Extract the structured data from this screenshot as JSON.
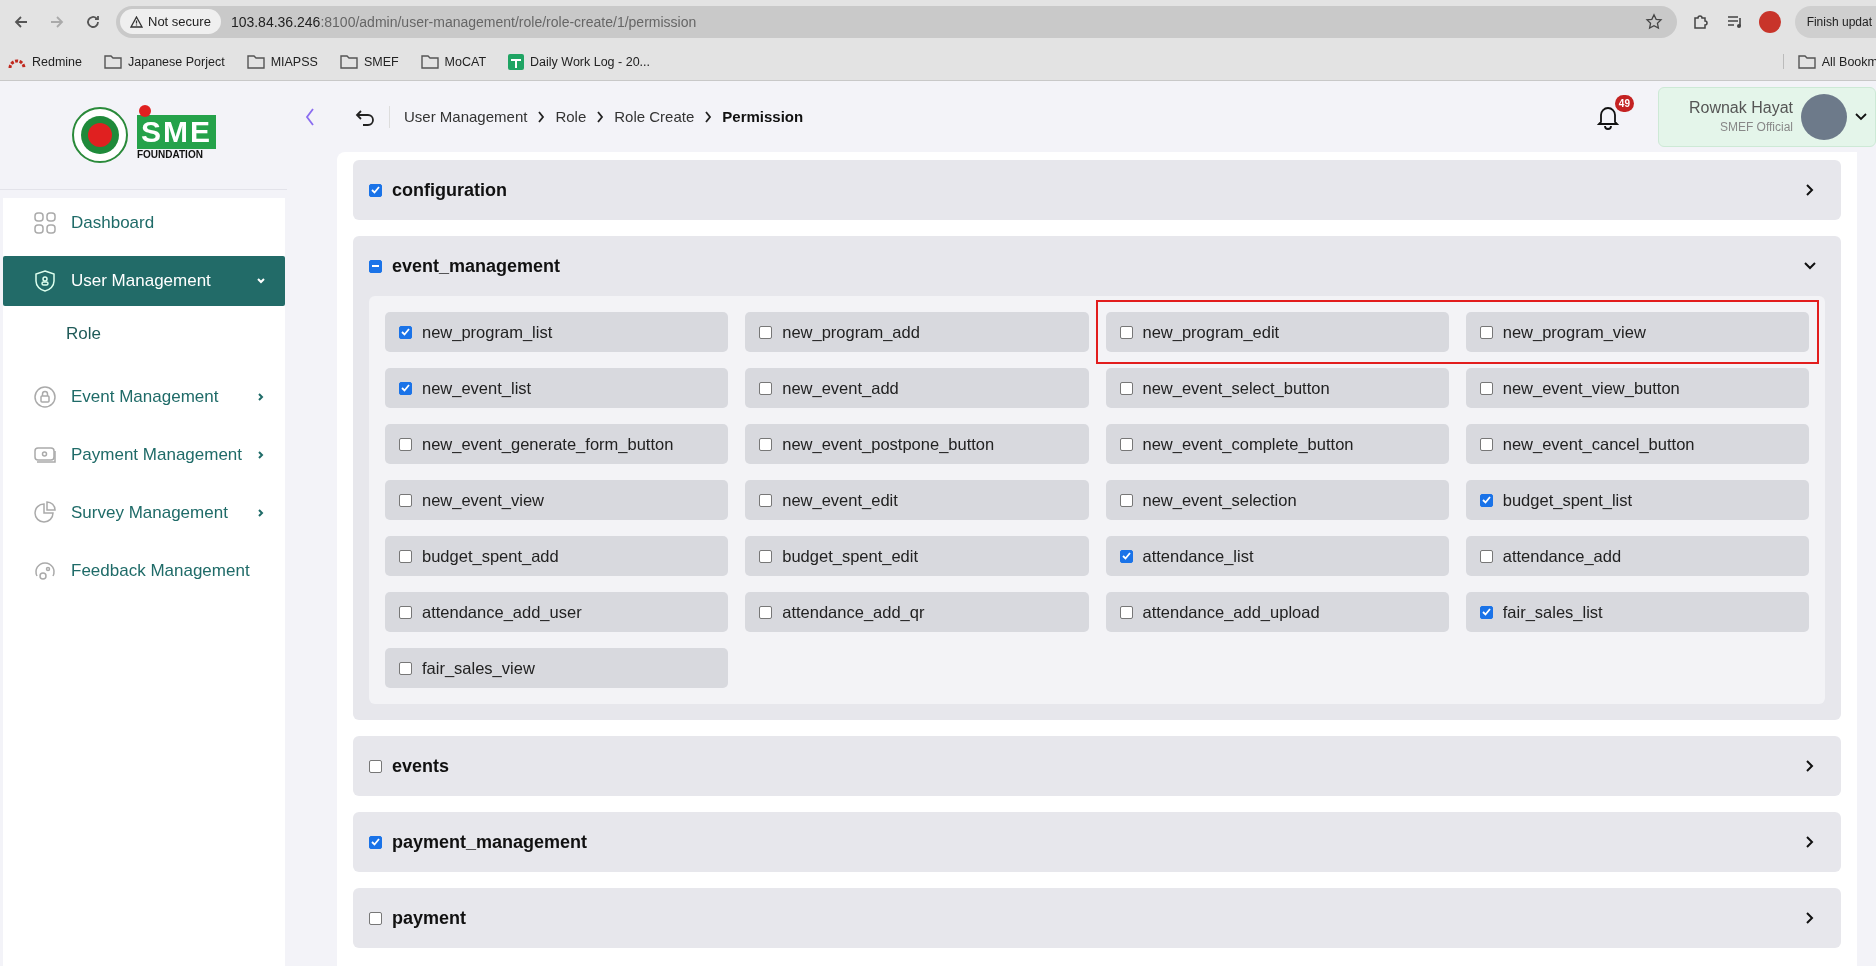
{
  "browser": {
    "security": "Not secure",
    "url_host": "103.84.36.246",
    "url_path": ":8100/admin/user-management/role/role-create/1/permission",
    "update_button": "Finish updat",
    "bookmarks": [
      {
        "kind": "redmine",
        "label": "Redmine"
      },
      {
        "kind": "folder",
        "label": "Japanese Porject"
      },
      {
        "kind": "folder",
        "label": "MIAPSS"
      },
      {
        "kind": "folder",
        "label": "SMEF"
      },
      {
        "kind": "folder",
        "label": "MoCAT"
      },
      {
        "kind": "sheet",
        "label": "Daily Work Log - 20..."
      }
    ],
    "all_bookmarks": "All Bookm"
  },
  "logo": {
    "letters": "SME",
    "caption": "FOUNDATION"
  },
  "breadcrumb": [
    {
      "label": "User Management",
      "current": false
    },
    {
      "label": "Role",
      "current": false
    },
    {
      "label": "Role Create",
      "current": false
    },
    {
      "label": "Permission",
      "current": true
    }
  ],
  "notifications": {
    "count": "49"
  },
  "user": {
    "name": "Rownak Hayat",
    "role": "SMEF Official"
  },
  "sidebar": {
    "items": [
      {
        "label": "Dashboard",
        "selected": false
      },
      {
        "label": "User Management",
        "selected": true,
        "expanded": true,
        "children": [
          {
            "label": "Role",
            "selected": false
          }
        ]
      },
      {
        "label": "Event Management",
        "selected": false,
        "expanded": false
      },
      {
        "label": "Payment Management",
        "selected": false,
        "expanded": false
      },
      {
        "label": "Survey Management",
        "selected": false,
        "expanded": false
      },
      {
        "label": "Feedback Management",
        "selected": false
      }
    ]
  },
  "sections": [
    {
      "title": "configuration",
      "checked": true,
      "expanded": false
    },
    {
      "title": "event_management",
      "indeterminate": true,
      "expanded": true,
      "permissions": [
        {
          "label": "new_program_list",
          "checked": true,
          "highlighted": false
        },
        {
          "label": "new_program_add",
          "checked": false,
          "highlighted": false
        },
        {
          "label": "new_program_edit",
          "checked": false,
          "highlighted": true
        },
        {
          "label": "new_program_view",
          "checked": false,
          "highlighted": true
        },
        {
          "label": "new_event_list",
          "checked": true,
          "highlighted": false
        },
        {
          "label": "new_event_add",
          "checked": false,
          "highlighted": false
        },
        {
          "label": "new_event_select_button",
          "checked": false,
          "highlighted": false
        },
        {
          "label": "new_event_view_button",
          "checked": false,
          "highlighted": false
        },
        {
          "label": "new_event_generate_form_button",
          "checked": false,
          "highlighted": false
        },
        {
          "label": "new_event_postpone_button",
          "checked": false,
          "highlighted": false
        },
        {
          "label": "new_event_complete_button",
          "checked": false,
          "highlighted": false
        },
        {
          "label": "new_event_cancel_button",
          "checked": false,
          "highlighted": false
        },
        {
          "label": "new_event_view",
          "checked": false,
          "highlighted": false
        },
        {
          "label": "new_event_edit",
          "checked": false,
          "highlighted": false
        },
        {
          "label": "new_event_selection",
          "checked": false,
          "highlighted": false
        },
        {
          "label": "budget_spent_list",
          "checked": true,
          "highlighted": false
        },
        {
          "label": "budget_spent_add",
          "checked": false,
          "highlighted": false
        },
        {
          "label": "budget_spent_edit",
          "checked": false,
          "highlighted": false
        },
        {
          "label": "attendance_list",
          "checked": true,
          "highlighted": false
        },
        {
          "label": "attendance_add",
          "checked": false,
          "highlighted": false
        },
        {
          "label": "attendance_add_user",
          "checked": false,
          "highlighted": false
        },
        {
          "label": "attendance_add_qr",
          "checked": false,
          "highlighted": false
        },
        {
          "label": "attendance_add_upload",
          "checked": false,
          "highlighted": false
        },
        {
          "label": "fair_sales_list",
          "checked": true,
          "highlighted": false
        },
        {
          "label": "fair_sales_view",
          "checked": false,
          "highlighted": false
        }
      ]
    },
    {
      "title": "events",
      "checked": false,
      "expanded": false
    },
    {
      "title": "payment_management",
      "checked": true,
      "expanded": false
    },
    {
      "title": "payment",
      "checked": false,
      "expanded": false
    }
  ]
}
